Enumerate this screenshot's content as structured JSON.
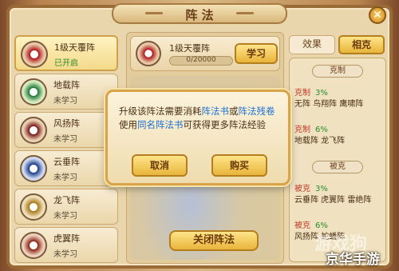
{
  "title": "阵 法",
  "close_glyph": "✕",
  "left_list": [
    {
      "name": "1级天覆阵",
      "status": "已开启",
      "active": true
    },
    {
      "name": "地载阵",
      "status": "未学习"
    },
    {
      "name": "风扬阵",
      "status": "未学习"
    },
    {
      "name": "云垂阵",
      "status": "未学习"
    },
    {
      "name": "龙飞阵",
      "status": "未学习"
    },
    {
      "name": "虎翼阵",
      "status": "未学习"
    }
  ],
  "detail": {
    "name": "1级天覆阵",
    "progress_text": "0/20000",
    "progress_fraction": 0,
    "learn_button": "学习"
  },
  "tabs": {
    "effect": "效果",
    "counter": "相克"
  },
  "counter_panel": {
    "restrain_header": "克制",
    "restrain": [
      {
        "label": "克制",
        "percent": "3%",
        "names": "无阵 鸟翔阵 鹰啸阵"
      },
      {
        "label": "克制",
        "percent": "6%",
        "names": "地载阵 龙飞阵"
      }
    ],
    "restrained_header": "被克",
    "restrained": [
      {
        "label": "被克",
        "percent": "3%",
        "names": "云垂阵 虎翼阵 雷绝阵"
      },
      {
        "label": "被克",
        "percent": "6%",
        "names": "风扬阵 蛇蟠阵"
      }
    ]
  },
  "close_array_button": "关闭阵法",
  "dialog": {
    "line1_a": "升级该阵法需要消耗",
    "line1_b": "阵法书",
    "line1_c": "或",
    "line1_d": "阵法残卷",
    "line2_a": "使用",
    "line2_b": "同名阵法书",
    "line2_c": "可获得更多阵法经验",
    "cancel": "取消",
    "buy": "购买"
  },
  "watermark": {
    "line1": "游戏狗",
    "line2": "京华手游"
  }
}
